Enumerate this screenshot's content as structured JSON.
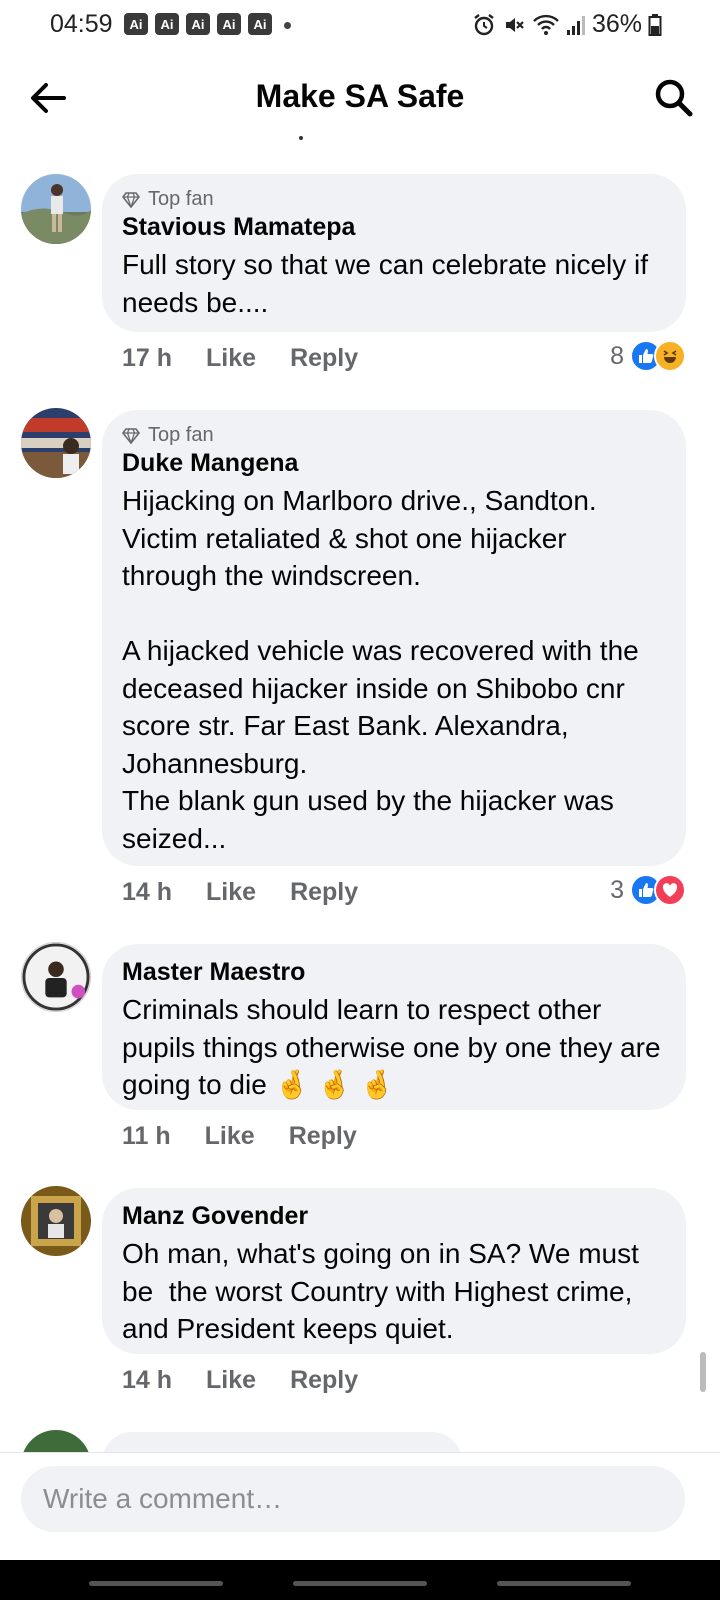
{
  "status_bar": {
    "time": "04:59",
    "badges": [
      "Ai",
      "Ai",
      "Ai",
      "Ai",
      "Ai"
    ],
    "battery": "36%"
  },
  "header": {
    "title": "Make SA Safe",
    "back_icon": "arrow-left-icon",
    "search_icon": "search-icon"
  },
  "comments": [
    {
      "badge": "Top fan",
      "author": "Stavious Mamatepa",
      "text": "Full story so that we can celebrate nicely if needs be....",
      "time": "17 h",
      "like": "Like",
      "reply": "Reply",
      "reaction_count": "8",
      "reactions": [
        "like",
        "haha"
      ]
    },
    {
      "badge": "Top fan",
      "author": "Duke Mangena",
      "text": "Hijacking on Marlboro drive., Sandton.\nVictim retaliated & shot one hijacker through the windscreen.\n\nA hijacked vehicle was recovered with the deceased hijacker inside on Shibobo cnr score str. Far East Bank. Alexandra, Johannesburg.\nThe blank gun used by the hijacker was seized...",
      "time": "14 h",
      "like": "Like",
      "reply": "Reply",
      "reaction_count": "3",
      "reactions": [
        "like",
        "love"
      ]
    },
    {
      "author": "Master Maestro",
      "text": "Criminals should learn to respect other pupils things otherwise one by one they are going to die 🤞 🤞 🤞",
      "time": "11 h",
      "like": "Like",
      "reply": "Reply"
    },
    {
      "author": "Manz Govender",
      "text": "Oh man, what's going on in SA? We must be  the worst Country with Highest crime, and President keeps quiet.",
      "time": "14 h",
      "like": "Like",
      "reply": "Reply"
    }
  ],
  "composer": {
    "placeholder": "Write a comment…"
  }
}
